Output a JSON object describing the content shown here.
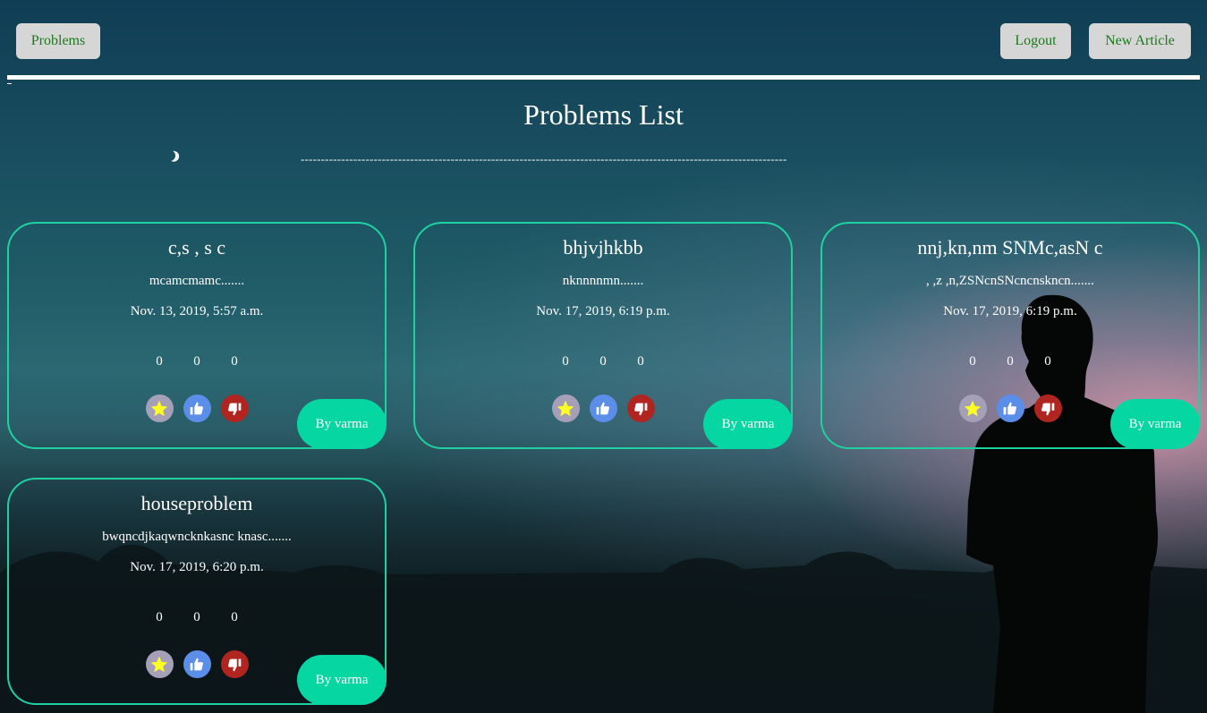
{
  "nav": {
    "problems_label": "Problems",
    "logout_label": "Logout",
    "new_article_label": "New Article"
  },
  "page": {
    "title": "Problems List",
    "divider": "------------------------------------------------------------------------------------------------------------------------"
  },
  "colors": {
    "nav_button_bg": "#d6d6d6",
    "nav_button_text": "#1b7a1b",
    "card_border": "#1fd1a0",
    "author_button": "#05d6a2",
    "star_bg": "#a59fb7",
    "star": "#ffff22",
    "like_bg": "#5b8ee8",
    "dislike_bg": "#b0251f"
  },
  "icons": [
    "star-icon",
    "thumbs-up-icon",
    "thumbs-down-icon",
    "moon-icon"
  ],
  "cards": [
    {
      "title": "c,s , s c",
      "description": "mcamcmamc.......",
      "date": "Nov. 13, 2019, 5:57 a.m.",
      "counts": [
        "0",
        "0",
        "0"
      ],
      "author": "By varma"
    },
    {
      "title": "bhjvjhkbb",
      "description": "nknnnnmn.......",
      "date": "Nov. 17, 2019, 6:19 p.m.",
      "counts": [
        "0",
        "0",
        "0"
      ],
      "author": "By varma"
    },
    {
      "title": "nnj,kn,nm SNMc,asN c",
      "description": ", ,z ,n,ZSNcnSNcncnskncn.......",
      "date": "Nov. 17, 2019, 6:19 p.m.",
      "counts": [
        "0",
        "0",
        "0"
      ],
      "author": "By varma"
    },
    {
      "title": "houseproblem",
      "description": "bwqncdjkaqwncknkasnc knasc.......",
      "date": "Nov. 17, 2019, 6:20 p.m.",
      "counts": [
        "0",
        "0",
        "0"
      ],
      "author": "By varma"
    }
  ]
}
